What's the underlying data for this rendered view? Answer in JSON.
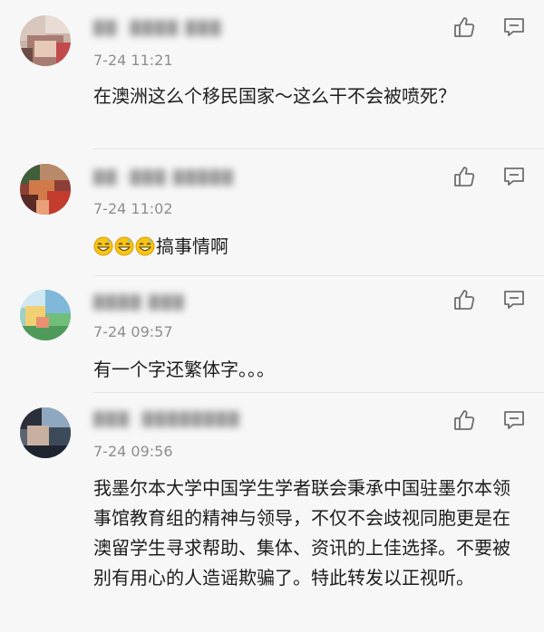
{
  "comments": [
    {
      "username": "██ ·████ ███",
      "time": "7-24 11:21",
      "text": "在澳洲这么个移民国家～这么干不会被喷死？",
      "like_icon": "thumbs-up-icon",
      "reply_icon": "comment-bubble-icon"
    },
    {
      "username": "██ ·███ █████",
      "time": "7-24 11:02",
      "emojis": [
        "grinning-sweat-emoji",
        "grinning-sweat-emoji",
        "grinning-sweat-emoji"
      ],
      "text": "搞事情啊",
      "like_icon": "thumbs-up-icon",
      "reply_icon": "comment-bubble-icon"
    },
    {
      "username": "████ ███",
      "time": "7-24 09:57",
      "text": "有一个字还繁体字。。。",
      "like_icon": "thumbs-up-icon",
      "reply_icon": "comment-bubble-icon"
    },
    {
      "username": "███ ·████████",
      "time": "7-24 09:56",
      "text": "我墨尔本大学中国学生学者联会秉承中国驻墨尔本领事馆教育组的精神与领导，不仅不会歧视同胞更是在澳留学生寻求帮助、集体、资讯的上佳选择。不要被别有用心的人造谣欺骗了。特此转发以正视听。",
      "like_icon": "thumbs-up-icon",
      "reply_icon": "comment-bubble-icon"
    }
  ]
}
